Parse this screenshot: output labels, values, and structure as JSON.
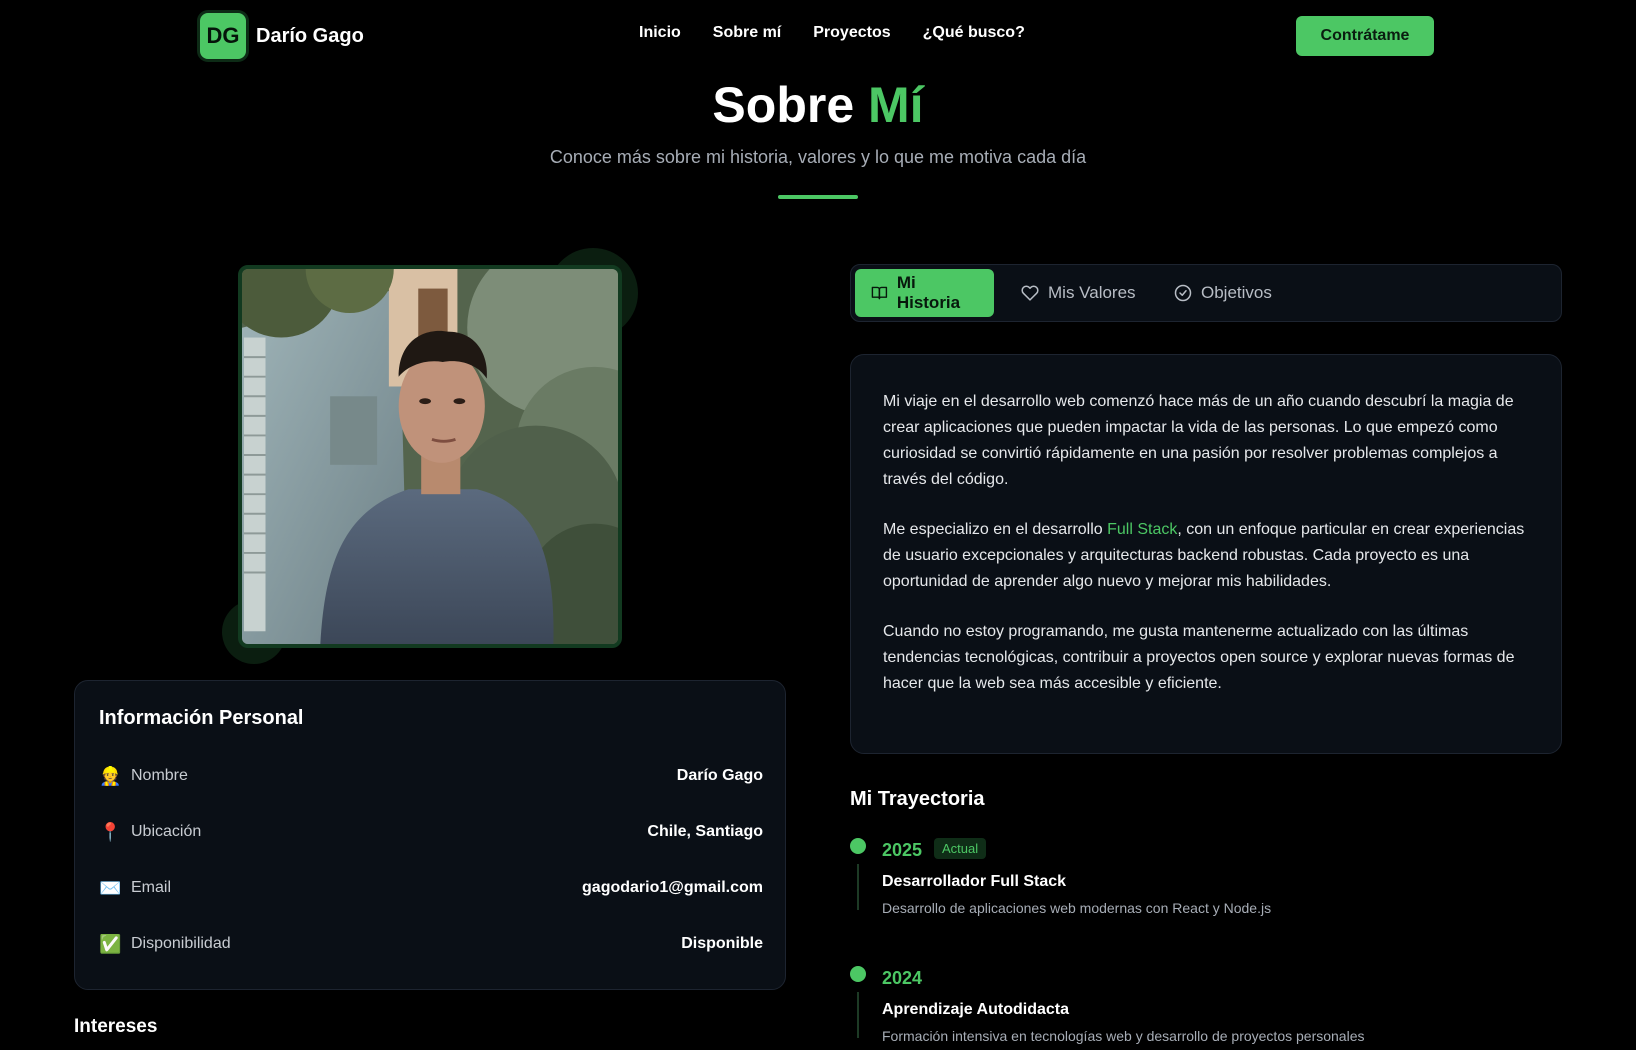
{
  "nav": {
    "logo_initials": "DG",
    "brand_name": "Darío Gago",
    "links": [
      "Inicio",
      "Sobre mí",
      "Proyectos",
      "¿Qué busco?"
    ],
    "cta_label": "Contrátame"
  },
  "hero": {
    "title_part1": "Sobre",
    "title_part2": "Mí",
    "subtitle": "Conoce más sobre mi historia, valores y lo que me motiva cada día"
  },
  "profile_photo": {
    "icon": "profile-photo"
  },
  "personal_info": {
    "title": "Información Personal",
    "rows": [
      {
        "emoji": "👷",
        "label": "Nombre",
        "value": "Darío Gago"
      },
      {
        "emoji": "📍",
        "label": "Ubicación",
        "value": "Chile, Santiago"
      },
      {
        "emoji": "✉️",
        "label": "Email",
        "value": "gagodario1@gmail.com"
      },
      {
        "emoji": "✅",
        "label": "Disponibilidad",
        "value": "Disponible"
      }
    ]
  },
  "interests": {
    "title": "Intereses"
  },
  "tabs": [
    {
      "label": "Mi Historia",
      "icon": "book-icon",
      "active": true
    },
    {
      "label": "Mis Valores",
      "icon": "heart-icon",
      "active": false
    },
    {
      "label": "Objetivos",
      "icon": "check-circle-icon",
      "active": false
    }
  ],
  "story": {
    "p1": "Mi viaje en el desarrollo web comenzó hace más de un año cuando descubrí la magia de crear aplicaciones que pueden impactar la vida de las personas. Lo que empezó como curiosidad se convirtió rápidamente en una pasión por resolver problemas complejos a través del código.",
    "p2_before": "Me especializo en el desarrollo ",
    "p2_highlight": "Full Stack",
    "p2_after": ", con un enfoque particular en crear experiencias de usuario excepcionales y arquitecturas backend robustas. Cada proyecto es una oportunidad de aprender algo nuevo y mejorar mis habilidades.",
    "p3": "Cuando no estoy programando, me gusta mantenerme actualizado con las últimas tendencias tecnológicas, contribuir a proyectos open source y explorar nuevas formas de hacer que la web sea más accesible y eficiente."
  },
  "timeline": {
    "title": "Mi Trayectoria",
    "items": [
      {
        "year": "2025",
        "badge": "Actual",
        "role": "Desarrollador Full Stack",
        "desc": "Desarrollo de aplicaciones web modernas con React y Node.js"
      },
      {
        "year": "2024",
        "role": "Aprendizaje Autodidacta",
        "desc": "Formación intensiva en tecnologías web y desarrollo de proyectos personales"
      }
    ]
  },
  "colors": {
    "accent": "#4cc764",
    "background": "#000000",
    "card": "#0a0f16",
    "card_border": "#1d2430",
    "muted_text": "#a7adb6"
  }
}
